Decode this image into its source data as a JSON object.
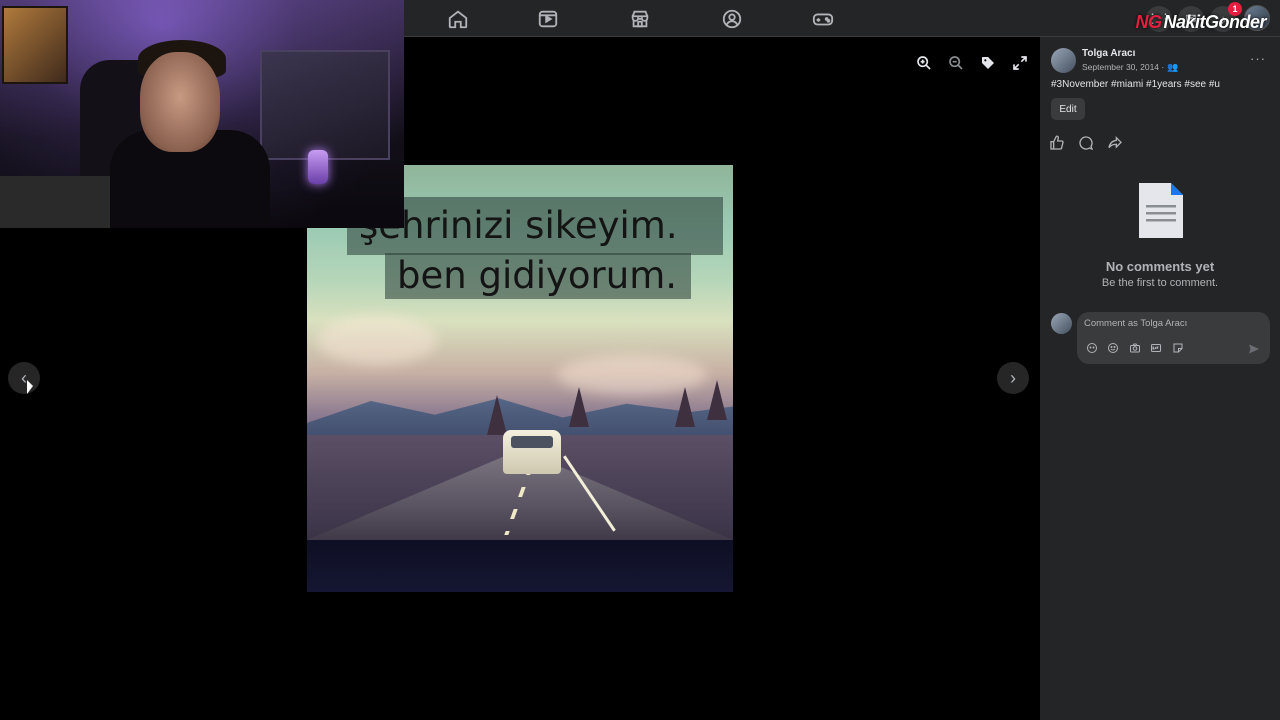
{
  "nav": {
    "items": [
      {
        "name": "home",
        "icon": "home-icon"
      },
      {
        "name": "video",
        "icon": "video-icon"
      },
      {
        "name": "marketplace",
        "icon": "marketplace-icon"
      },
      {
        "name": "groups",
        "icon": "groups-icon"
      },
      {
        "name": "gaming",
        "icon": "gaming-icon"
      }
    ],
    "notification_count": "1",
    "watermark_prefix": "NG",
    "watermark_text": "NakitGonder"
  },
  "photo": {
    "line1": "şehrinizi sikeyim.",
    "line2": "ben gidiyorum."
  },
  "post": {
    "author": "Tolga Aracı",
    "date": "September 30, 2014 ·",
    "caption": "#3November #miami #1years #see #u",
    "edit_label": "Edit",
    "more_label": "···"
  },
  "comments": {
    "empty_title": "No comments yet",
    "empty_subtitle": "Be the first to comment.",
    "placeholder": "Comment as Tolga Aracı"
  },
  "colors": {
    "panel_bg": "#242526",
    "topbar_bg": "#242526",
    "accent_red": "#e41e3f",
    "text_primary": "#e4e6eb",
    "text_secondary": "#b0b3b8"
  }
}
